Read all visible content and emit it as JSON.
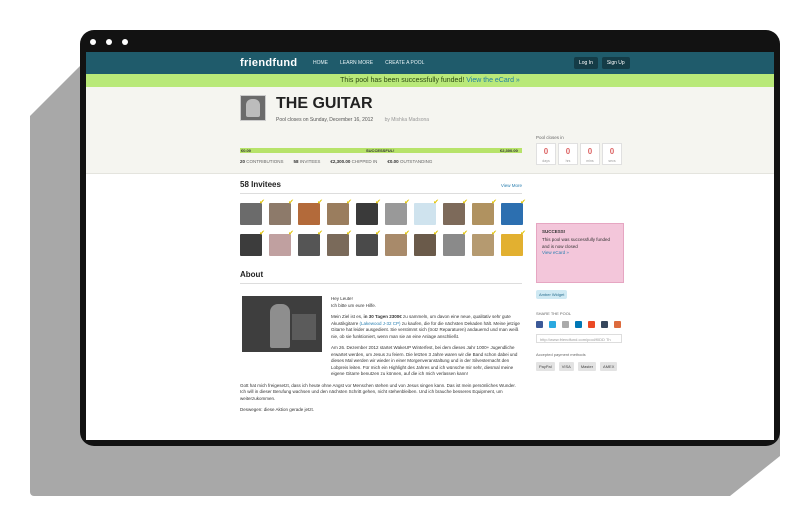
{
  "nav": {
    "logo": "friendfund",
    "links": [
      "HOME",
      "LEARN MORE",
      "CREATE A POOL"
    ],
    "login": "Log In",
    "signup": "Sign Up"
  },
  "banner": {
    "text": "This pool has been successfully funded!",
    "link": "View the eCard »"
  },
  "header": {
    "title": "THE GUITAR",
    "closes": "Pool closes on Sunday, December 16, 2012",
    "by": "by Mishka Madsona",
    "progress_left": "€0.00",
    "progress_mid": "SUCCESSFUL!",
    "progress_right": "€2,300.00",
    "progress_fraction": 1.0,
    "stats": {
      "contributions": "20",
      "contributions_label": "CONTRIBUTIONS",
      "invitees": "58",
      "invitees_label": "INVITEES",
      "chipped": "€2,300.00",
      "chipped_label": "CHIPPED IN",
      "outstanding": "€0.00",
      "outstanding_label": "OUTSTANDING"
    }
  },
  "countdown": {
    "title": "Pool closes in",
    "boxes": [
      {
        "num": "0",
        "unit": "days"
      },
      {
        "num": "0",
        "unit": "hrs"
      },
      {
        "num": "0",
        "unit": "mins"
      },
      {
        "num": "0",
        "unit": "secs"
      }
    ]
  },
  "invitees": {
    "title": "58 Invitees",
    "view_more": "View More",
    "avatar_colors": [
      "#6b6b6b",
      "#8d7a6a",
      "#b36a3a",
      "#9a7d5e",
      "#3a3a3a",
      "#999999",
      "#cfe3ee",
      "#7d6a5a",
      "#b09260",
      "#2c6fb0",
      "#3c3c3c",
      "#c0a0a0",
      "#555555",
      "#7a6a5a",
      "#4a4a4a",
      "#a88a6a",
      "#6a5a4a",
      "#8a8a8a",
      "#b59a70",
      "#e2b030"
    ]
  },
  "about": {
    "title": "About",
    "p1a": "Hey Leute!",
    "p1b": "Ich bitte um eure Hilfe.",
    "p2_pre": "Mein Ziel ist es,",
    "p2_bold": "in 30 Tagen 2300€",
    "p2_mid": "zu sammeln, um davon eine neue, qualitativ sehr gute Akustikgitarre",
    "p2_link": "(Lakewood J-32 CP)",
    "p2_post": "zu kaufen, die für die nächsten Dekaden hält. Meine jetzige Gitarre hat leider ausgedient. Sie verstimmt sich (trotz Reparaturen) andauernd und man weiß nie, ob sie funktioniert, wenn man sie an eine Anlage anschließt.",
    "p3": "Am 26. Dezember 2012 startet WakeUP Winterfest, bei dem dieses Jahr 1000+ Jugendliche erwartet werden, um Jesus zu feiern. Die letzten 3 Jahre waren wir die Band schon dabei und dieses Mal werden wir wieder in einer Morgenveranstaltung und in der Silvesternacht den Lobpreis leiten. Für mich ein Highlight des Jahres und ich wünsche mir sehr, diesmal meine eigene Gitarre benutzen zu können, auf die ich mich verlassen kann!",
    "p4": "Gott hat mich freigesetzt, dass ich heute ohne Angst vor Menschen stehen und von Jesus singen kann. Das ist mein persönliches Wunder. Ich will in dieser Berufung wachsen und den nächsten Schritt gehen, nicht stehenbleiben. Und ich brauche besseres Equipment, um weiterzukommen.",
    "p5": "Deswegen: diese Aktion gerade jetzt."
  },
  "sidebar": {
    "success_title": "SUCCESS!",
    "success_text": "This pool was successfully funded and is now closed",
    "success_link": "View eCard »",
    "tag": "Amber Widget",
    "share_title": "SHARE THE POOL",
    "share_icons": [
      {
        "name": "facebook-icon",
        "color": "#3b5998"
      },
      {
        "name": "twitter-icon",
        "color": "#2aa9e0"
      },
      {
        "name": "email-icon",
        "color": "#aaaaaa"
      },
      {
        "name": "linkedin-icon",
        "color": "#0077b5"
      },
      {
        "name": "stumbleupon-icon",
        "color": "#eb4924"
      },
      {
        "name": "tumblr-icon",
        "color": "#35465c"
      },
      {
        "name": "plus-icon",
        "color": "#dd6b3d"
      }
    ],
    "share_url": "http://www.friendfund.com/pool/f0DD Th",
    "pay_title": "Accepted payment methods",
    "payments": [
      "PayPal",
      "VISA",
      "Master",
      "AMEX"
    ]
  }
}
